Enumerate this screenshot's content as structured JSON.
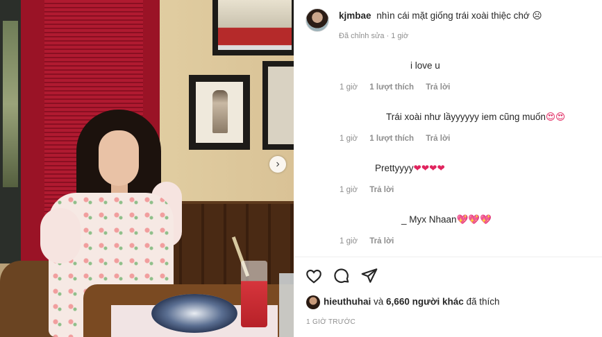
{
  "post": {
    "author": "kjmbae",
    "caption": "nhìn cái mặt giống trái xoài thiệc chớ",
    "caption_emoji": "☹",
    "edited": "Đã chỉnh sửa · 1 giờ"
  },
  "comments": [
    {
      "text": "i love u",
      "time": "1 giờ",
      "likes": "1 lượt thích",
      "reply": "Trả lời"
    },
    {
      "text": "Trái xoài như lầyyyyyy iem cũng muốn",
      "emoji": "😍😍",
      "time": "1 giờ",
      "likes": "1 lượt thích",
      "reply": "Trả lời"
    },
    {
      "text": "Prettyyyy",
      "emoji": "❤❤❤❤",
      "time": "1 giờ",
      "reply": "Trả lời"
    },
    {
      "text": "_ Myx Nhaan",
      "emoji": "💖💖💖",
      "time": "1 giờ",
      "reply": "Trả lời"
    }
  ],
  "actions": {
    "like_icon": "heart-outline-icon",
    "comment_icon": "comment-bubble-icon",
    "share_icon": "paper-plane-icon"
  },
  "likes_summary": {
    "user": "hieuthuhai",
    "connector": "và",
    "others": "6,660 người khác",
    "suffix": "đã thích"
  },
  "posted_ago": "1 GIỜ TRƯỚC",
  "carousel_next": "›",
  "colors": {
    "text": "#262626",
    "meta": "#8e8e8e",
    "heart": "#e0245e"
  }
}
